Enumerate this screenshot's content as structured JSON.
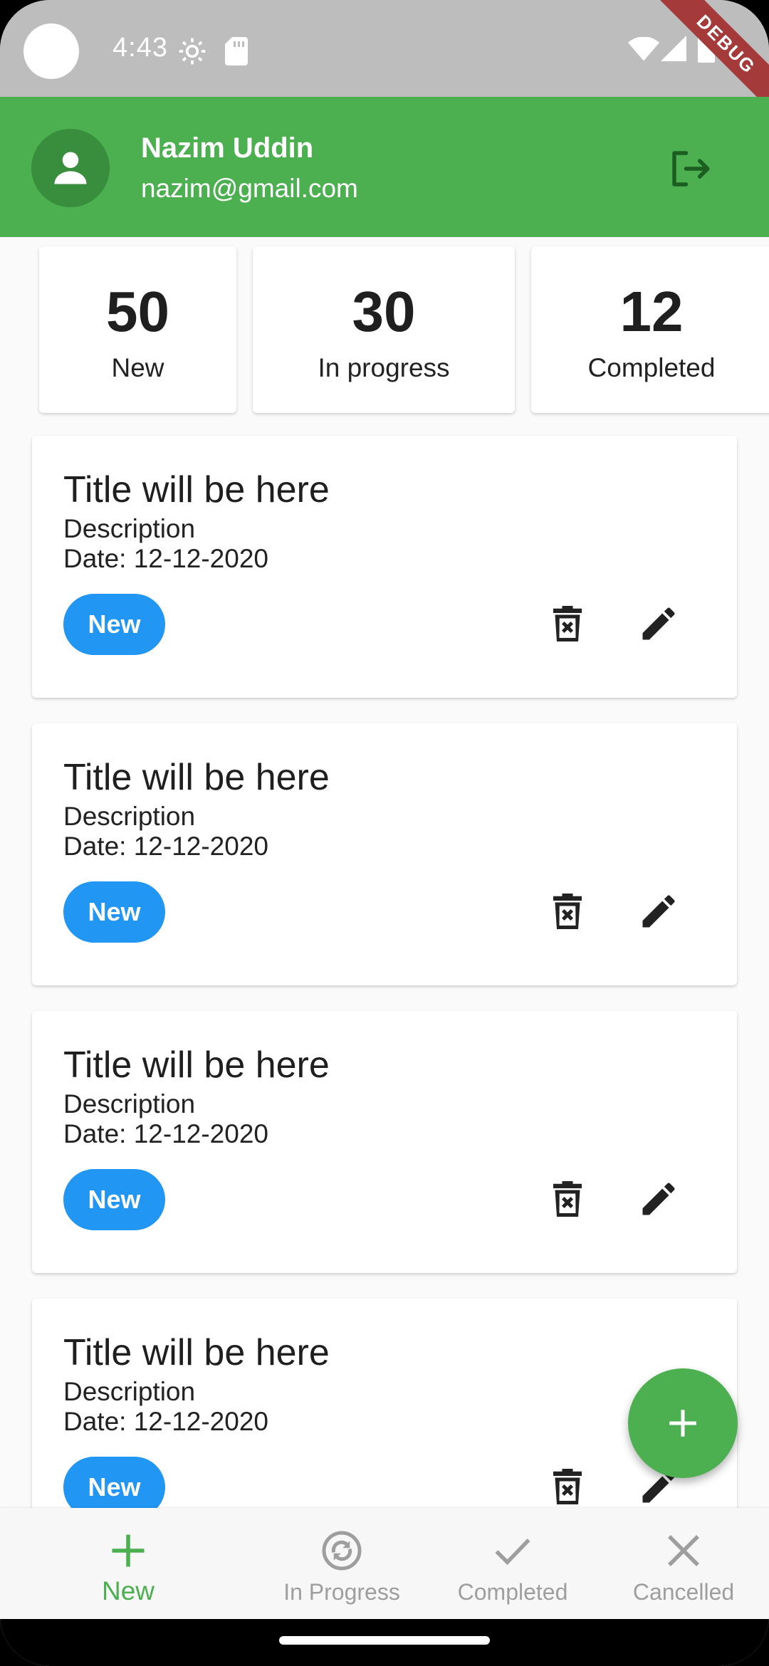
{
  "status_bar": {
    "time": "4:43",
    "debug_label": "DEBUG"
  },
  "header": {
    "user_name": "Nazim Uddin",
    "user_email": "nazim@gmail.com"
  },
  "summary": [
    {
      "count": "50",
      "label": "New"
    },
    {
      "count": "30",
      "label": "In progress"
    },
    {
      "count": "12",
      "label": "Completed"
    }
  ],
  "tasks": [
    {
      "title": "Title will be here",
      "description": "Description",
      "date": "Date: 12-12-2020",
      "status": "New"
    },
    {
      "title": "Title will be here",
      "description": "Description",
      "date": "Date: 12-12-2020",
      "status": "New"
    },
    {
      "title": "Title will be here",
      "description": "Description",
      "date": "Date: 12-12-2020",
      "status": "New"
    },
    {
      "title": "Title will be here",
      "description": "Description",
      "date": "Date: 12-12-2020",
      "status": "New"
    }
  ],
  "bottom_nav": [
    {
      "label": "New",
      "icon": "plus-icon",
      "active": true
    },
    {
      "label": "In Progress",
      "icon": "sync-icon",
      "active": false
    },
    {
      "label": "Completed",
      "icon": "check-icon",
      "active": false
    },
    {
      "label": "Cancelled",
      "icon": "close-icon",
      "active": false
    }
  ],
  "colors": {
    "primary": "#4caf50",
    "chip": "#2196f3",
    "inactive": "#9e9e9e"
  }
}
